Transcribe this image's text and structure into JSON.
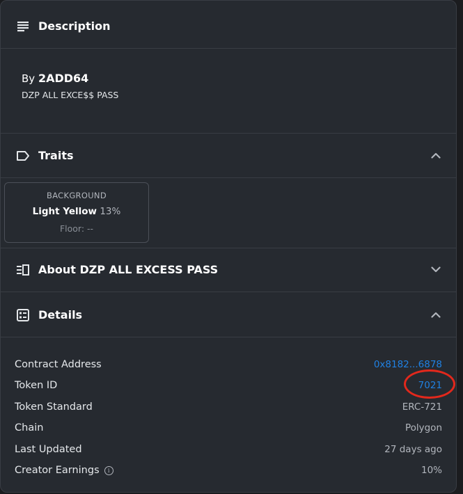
{
  "description": {
    "header": "Description",
    "by_prefix": "By",
    "creator": "2ADD64",
    "text": "DZP ALL EXCE$$ PASS"
  },
  "traits": {
    "header": "Traits",
    "items": [
      {
        "type": "BACKGROUND",
        "value": "Light Yellow",
        "percent": "13%",
        "floor": "Floor: --"
      }
    ]
  },
  "about": {
    "header": "About DZP ALL EXCESS PASS"
  },
  "details": {
    "header": "Details",
    "rows": [
      {
        "label": "Contract Address",
        "value": "0x8182...6878"
      },
      {
        "label": "Token ID",
        "value": "7021"
      },
      {
        "label": "Token Standard",
        "value": "ERC-721"
      },
      {
        "label": "Chain",
        "value": "Polygon"
      },
      {
        "label": "Last Updated",
        "value": "27 days ago"
      },
      {
        "label": "Creator Earnings",
        "value": "10%"
      }
    ]
  },
  "colors": {
    "link": "#2081e2",
    "highlight": "#e2281c",
    "panel_bg": "#262a30"
  }
}
